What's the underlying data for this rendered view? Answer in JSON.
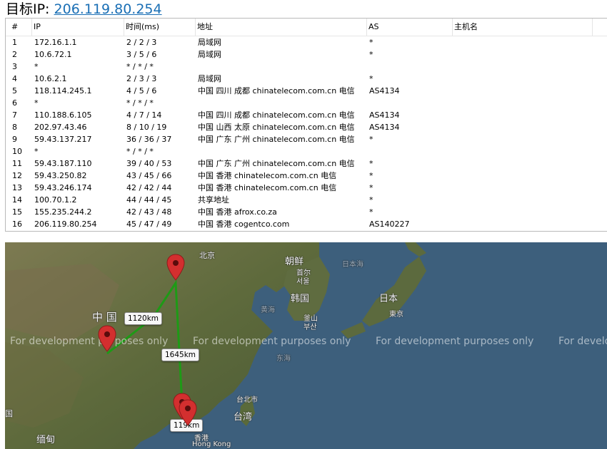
{
  "header": {
    "label": "目标IP:",
    "target_ip": "206.119.80.254"
  },
  "table": {
    "columns": [
      "#",
      "IP",
      "时间(ms)",
      "地址",
      "AS",
      "主机名"
    ],
    "rows": [
      {
        "num": "1",
        "ip": "172.16.1.1",
        "time": "2 / 2 / 3",
        "addr": "局域网",
        "as": "*",
        "host": ""
      },
      {
        "num": "2",
        "ip": "10.6.72.1",
        "time": "3 / 5 / 6",
        "addr": "局域网",
        "as": "*",
        "host": ""
      },
      {
        "num": "3",
        "ip": "*",
        "time": "* / * / *",
        "addr": "",
        "as": "",
        "host": ""
      },
      {
        "num": "4",
        "ip": "10.6.2.1",
        "time": "2 / 3 / 3",
        "addr": "局域网",
        "as": "*",
        "host": ""
      },
      {
        "num": "5",
        "ip": "118.114.245.1",
        "time": "4 / 5 / 6",
        "addr": "中国 四川 成都 chinatelecom.com.cn 电信",
        "as": "AS4134",
        "host": ""
      },
      {
        "num": "6",
        "ip": "*",
        "time": "* / * / *",
        "addr": "",
        "as": "",
        "host": ""
      },
      {
        "num": "7",
        "ip": "110.188.6.105",
        "time": "4 / 7 / 14",
        "addr": "中国 四川 成都 chinatelecom.com.cn 电信",
        "as": "AS4134",
        "host": ""
      },
      {
        "num": "8",
        "ip": "202.97.43.46",
        "time": "8 / 10 / 19",
        "addr": "中国 山西 太原 chinatelecom.com.cn 电信",
        "as": "AS4134",
        "host": ""
      },
      {
        "num": "9",
        "ip": "59.43.137.217",
        "time": "36 / 36 / 37",
        "addr": "中国 广东 广州 chinatelecom.com.cn 电信",
        "as": "*",
        "host": ""
      },
      {
        "num": "10",
        "ip": "*",
        "time": "* / * / *",
        "addr": "",
        "as": "",
        "host": ""
      },
      {
        "num": "11",
        "ip": "59.43.187.110",
        "time": "39 / 40 / 53",
        "addr": "中国 广东 广州 chinatelecom.com.cn 电信",
        "as": "*",
        "host": ""
      },
      {
        "num": "12",
        "ip": "59.43.250.82",
        "time": "43 / 45 / 66",
        "addr": "中国 香港 chinatelecom.com.cn 电信",
        "as": "*",
        "host": ""
      },
      {
        "num": "13",
        "ip": "59.43.246.174",
        "time": "42 / 42 / 44",
        "addr": "中国 香港 chinatelecom.com.cn 电信",
        "as": "*",
        "host": ""
      },
      {
        "num": "14",
        "ip": "100.70.1.2",
        "time": "44 / 44 / 45",
        "addr": "共享地址",
        "as": "*",
        "host": ""
      },
      {
        "num": "15",
        "ip": "155.235.244.2",
        "time": "42 / 43 / 48",
        "addr": "中国 香港 afrox.co.za",
        "as": "*",
        "host": ""
      },
      {
        "num": "16",
        "ip": "206.119.80.254",
        "time": "45 / 47 / 49",
        "addr": "中国 香港 cogentco.com",
        "as": "AS140227",
        "host": ""
      }
    ]
  },
  "map": {
    "watermark": "For development purposes only",
    "distances": [
      "1120km",
      "1645km",
      "119km"
    ],
    "labels": {
      "beijing": "北京",
      "korea": "朝鲜",
      "pyongyang1": "首尔",
      "pyongyang2": "서울",
      "south_korea": "韩国",
      "japan_sea": "日本海",
      "japan": "日本",
      "tokyo": "東京",
      "china": "中 国",
      "yellow_sea": "黄海",
      "busan1": "釜山",
      "busan2": "부산",
      "east_sea": "东海",
      "taipei": "台北市",
      "taiwan": "台湾",
      "myanmar": "缅甸",
      "hk1": "香港",
      "hk2": "Hong Kong",
      "edge": "国"
    }
  }
}
